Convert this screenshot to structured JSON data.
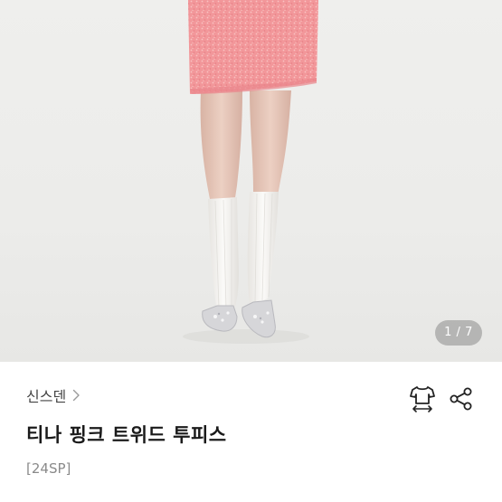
{
  "gallery": {
    "counter": "1 / 7",
    "colors": {
      "background": "#ecece9",
      "skirt": "#f2979a",
      "skin": "#e8c9bb",
      "socks": "#f4f3f0",
      "shoes": "#d9d9dc"
    }
  },
  "product": {
    "brand": "신스덴",
    "title": "티나 핑크 트위드 투피스",
    "season": "[24SP]"
  },
  "actions": {
    "size_icon": "clothing-size-icon",
    "share_icon": "share-icon"
  }
}
